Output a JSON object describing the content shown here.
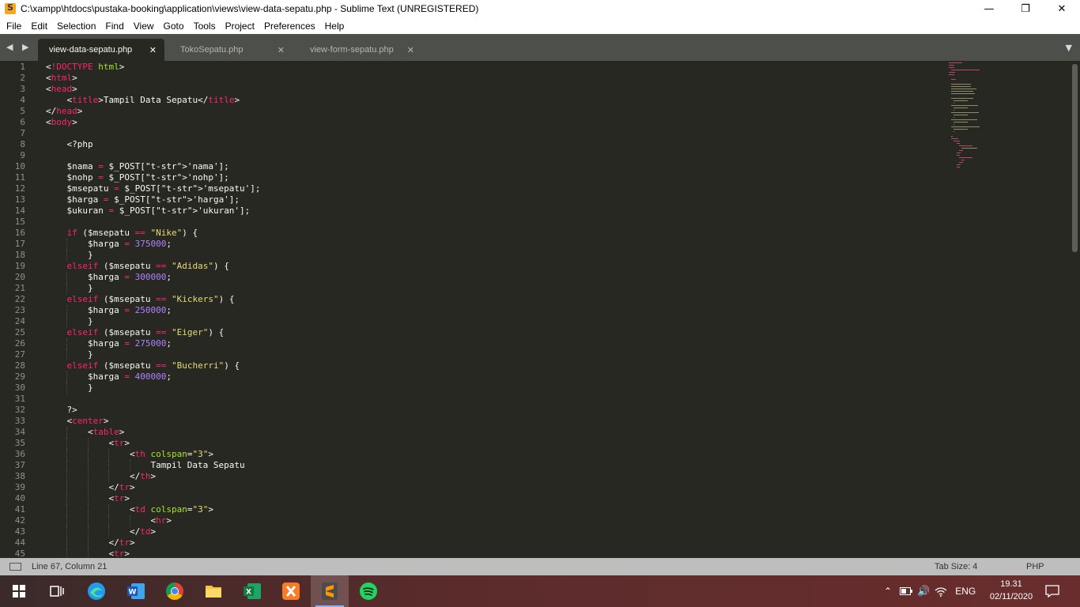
{
  "window": {
    "title": "C:\\xampp\\htdocs\\pustaka-booking\\application\\views\\view-data-sepatu.php - Sublime Text (UNREGISTERED)",
    "minimize": "—",
    "maximize": "❐",
    "close": "✕"
  },
  "menu": [
    "File",
    "Edit",
    "Selection",
    "Find",
    "View",
    "Goto",
    "Tools",
    "Project",
    "Preferences",
    "Help"
  ],
  "tabs": [
    {
      "label": "view-data-sepatu.php",
      "active": true
    },
    {
      "label": "TokoSepatu.php",
      "active": false
    },
    {
      "label": "view-form-sepatu.php",
      "active": false
    }
  ],
  "tab_nav": "◀ ▶",
  "tab_close": "✕",
  "tab_dropdown": "▼",
  "status": {
    "position": "Line 67, Column 21",
    "tab_size": "Tab Size: 4",
    "syntax": "PHP"
  },
  "clock": {
    "time": "19.31",
    "date": "02/11/2020"
  },
  "tray": {
    "language": "ENG"
  },
  "colors": {
    "editor_bg": "#272822",
    "tag": "#f92672",
    "attr": "#a6e22e",
    "string": "#e6db74",
    "number": "#ae81ff"
  },
  "code_lines": [
    "<!DOCTYPE html>",
    "<html>",
    "<head>",
    "    <title>Tampil Data Sepatu</title>",
    "</head>",
    "<body>",
    "",
    "    <?php",
    "",
    "    $nama = $_POST['nama'];",
    "    $nohp = $_POST['nohp'];",
    "    $msepatu = $_POST['msepatu'];",
    "    $harga = $_POST['harga'];",
    "    $ukuran = $_POST['ukuran'];",
    "",
    "    if ($msepatu == \"Nike\") {",
    "        $harga = 375000;",
    "        }",
    "    elseif ($msepatu == \"Adidas\") {",
    "        $harga = 300000;",
    "        }",
    "    elseif ($msepatu == \"Kickers\") {",
    "        $harga = 250000;",
    "        }",
    "    elseif ($msepatu == \"Eiger\") {",
    "        $harga = 275000;",
    "        }",
    "    elseif ($msepatu == \"Bucherri\") {",
    "        $harga = 400000;",
    "        }",
    "",
    "    ?>",
    "    <center>",
    "        <table>",
    "            <tr>",
    "                <th colspan=\"3\">",
    "                    Tampil Data Sepatu",
    "                </th>",
    "            </tr>",
    "            <tr>",
    "                <td colspan=\"3\">",
    "                    <hr>",
    "                </td>",
    "            </tr>",
    "            <tr>"
  ]
}
